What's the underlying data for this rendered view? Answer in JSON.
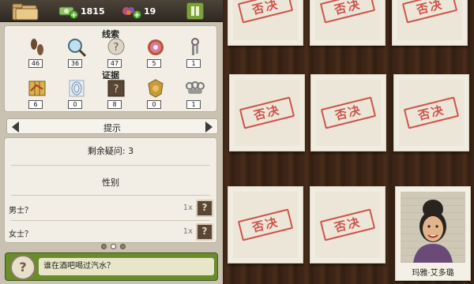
{
  "top_bar": {
    "cash": "1815",
    "candy": "19",
    "plus_symbol": "+"
  },
  "clues": {
    "title": "线索",
    "items": [
      {
        "icon": "footprints-icon",
        "count": "46"
      },
      {
        "icon": "magnifier-icon",
        "count": "36"
      },
      {
        "icon": "question-icon",
        "count": "47"
      },
      {
        "icon": "donut-icon",
        "count": "5"
      },
      {
        "icon": "keys-icon",
        "count": "1"
      }
    ]
  },
  "evidence": {
    "title": "证据",
    "items": [
      {
        "icon": "map-icon",
        "count": "6"
      },
      {
        "icon": "fingerprint-icon",
        "count": "0"
      },
      {
        "icon": "dossier-icon",
        "count": "8"
      },
      {
        "icon": "badge-icon",
        "count": "0"
      },
      {
        "icon": "knuckles-icon",
        "count": "1"
      }
    ]
  },
  "hint": {
    "label": "提示",
    "remaining": "剩余疑问: 3",
    "category": "性别",
    "options": [
      {
        "label": "男士？",
        "count": "1x"
      },
      {
        "label": "女士？",
        "count": "1x"
      }
    ]
  },
  "pager": {
    "total": 3,
    "active": 2
  },
  "question": {
    "text": "谁在酒吧喝过汽水？"
  },
  "board": {
    "stamp_text": "否决",
    "suspect_name": "玛雅·艾多璐"
  },
  "colors": {
    "stamp": "#c83b33",
    "accent_green": "#6a8c2c"
  }
}
